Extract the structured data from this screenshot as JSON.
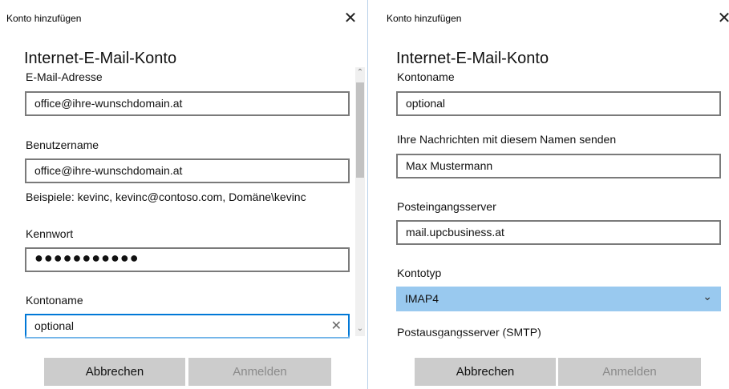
{
  "left_dialog": {
    "title": "Konto hinzufügen",
    "close_glyph": "✕",
    "heading": "Internet-E-Mail-Konto",
    "email_label": "E-Mail-Adresse",
    "email_value": "office@ihre-wunschdomain.at",
    "username_label": "Benutzername",
    "username_value": "office@ihre-wunschdomain.at",
    "username_hint": "Beispiele: kevinc, kevinc@contoso.com, Domäne\\kevinc",
    "password_label": "Kennwort",
    "password_value": "●●●●●●●●●●●",
    "account_name_label": "Kontoname",
    "account_name_value": "optional",
    "clear_glyph": "✕",
    "scroll_up_glyph": "⌃",
    "scroll_down_glyph": "⌄",
    "cancel_label": "Abbrechen",
    "signin_label": "Anmelden"
  },
  "right_dialog": {
    "title": "Konto hinzufügen",
    "close_glyph": "✕",
    "heading": "Internet-E-Mail-Konto",
    "account_name_label": "Kontoname",
    "account_name_value": "optional",
    "sender_name_label": "Ihre Nachrichten mit diesem Namen senden",
    "sender_name_value": "Max Mustermann",
    "incoming_server_label": "Posteingangsserver",
    "incoming_server_value": "mail.upcbusiness.at",
    "account_type_label": "Kontotyp",
    "account_type_value": "IMAP4",
    "account_type_chevron": "⌄",
    "outgoing_server_label": "Postausgangsserver (SMTP)",
    "cancel_label": "Abbrechen",
    "signin_label": "Anmelden"
  },
  "colors": {
    "focus_border": "#0078d7",
    "select_highlight": "#99c9ef",
    "button_bg": "#cccccc",
    "field_border": "#7a7a7a"
  }
}
